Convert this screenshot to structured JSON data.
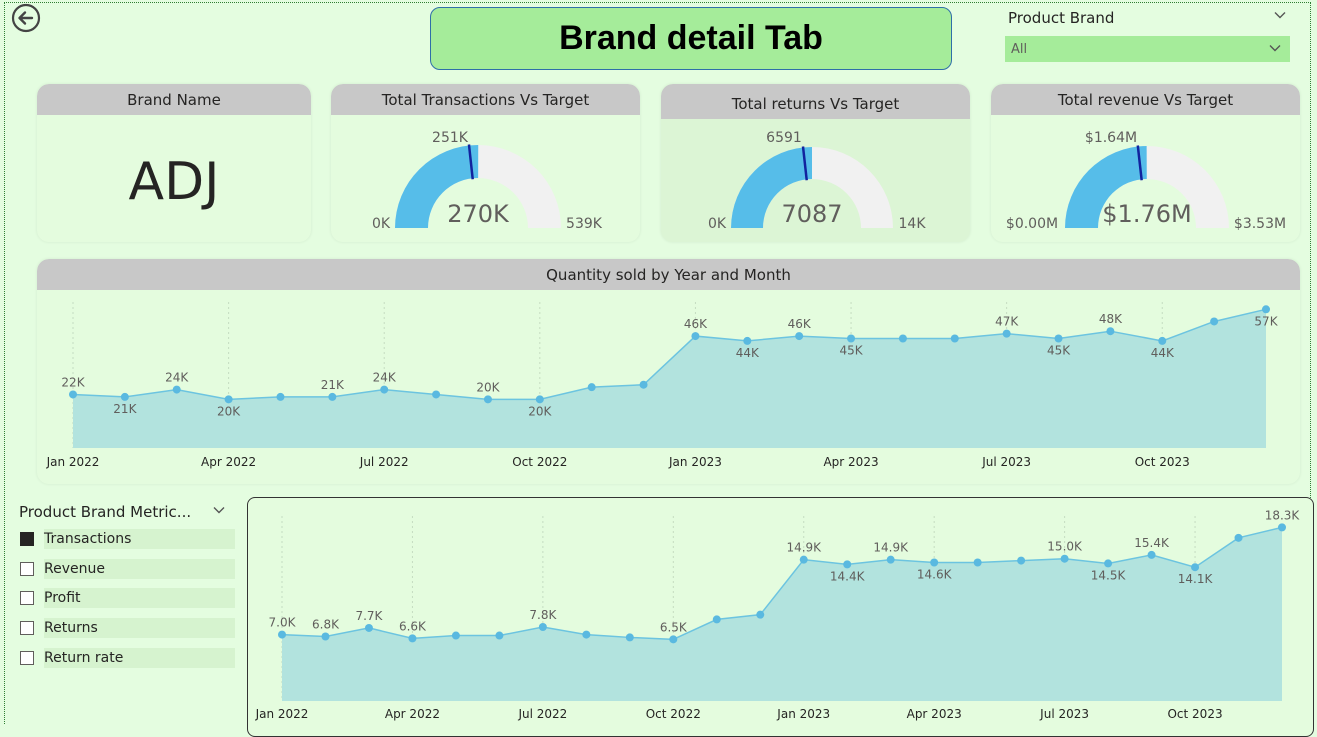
{
  "header": {
    "title": "Brand detail Tab"
  },
  "slicer": {
    "title": "Product Brand",
    "selected": "All"
  },
  "kpi": {
    "brand": {
      "title": "Brand Name",
      "value": "ADJ"
    },
    "transactions": {
      "title": "Total Transactions Vs Target",
      "value": "270K",
      "target": "251K",
      "min": "0K",
      "max": "539K",
      "value_num": 270,
      "target_num": 251,
      "max_num": 539
    },
    "returns": {
      "title": "Total returns Vs Target",
      "value": "7087",
      "target": "6591",
      "min": "0K",
      "max": "14K",
      "value_num": 7087,
      "target_num": 6591,
      "max_num": 14174
    },
    "revenue": {
      "title": "Total revenue Vs Target",
      "value": "$1.76M",
      "target": "$1.64M",
      "min": "$0.00M",
      "max": "$3.53M",
      "value_num": 1.76,
      "target_num": 1.64,
      "max_num": 3.53
    }
  },
  "colors": {
    "fill": "#56bde9",
    "track": "#f1f1f1",
    "target": "#12239e",
    "area": "#b2e3de",
    "line": "#6cc4e0",
    "point": "#5ab9e0"
  },
  "metric_slicer": {
    "title": "Product Brand Metric...",
    "items": [
      {
        "label": "Transactions",
        "checked": true
      },
      {
        "label": "Revenue",
        "checked": false
      },
      {
        "label": "Profit",
        "checked": false
      },
      {
        "label": "Returns",
        "checked": false
      },
      {
        "label": "Return rate",
        "checked": false
      }
    ]
  },
  "chart_data": [
    {
      "type": "area",
      "title": "Quantity sold by Year and Month",
      "x_ticks": [
        "Jan 2022",
        "Apr 2022",
        "Jul 2022",
        "Oct 2022",
        "Jan 2023",
        "Apr 2023",
        "Jul 2023",
        "Oct 2023"
      ],
      "values": [
        22,
        21,
        24,
        20,
        21,
        21,
        24,
        22,
        20,
        20,
        25,
        26,
        46,
        44,
        46,
        45,
        45,
        45,
        47,
        45,
        48,
        44,
        52,
        57
      ],
      "labels": [
        "22K",
        "21K",
        "24K",
        "20K",
        "",
        "21K",
        "24K",
        "",
        "20K",
        "20K",
        "",
        "",
        "46K",
        "44K",
        "46K",
        "45K",
        "",
        "",
        "47K",
        "45K",
        "48K",
        "44K",
        "",
        "57K"
      ],
      "label_pos": [
        "a",
        "b",
        "a",
        "b",
        "",
        "a",
        "a",
        "",
        "a",
        "b",
        "",
        "",
        "a",
        "b",
        "a",
        "b",
        "",
        "",
        "a",
        "b",
        "a",
        "b",
        "",
        "b"
      ],
      "ylim": [
        0,
        60
      ]
    },
    {
      "type": "area",
      "title": "",
      "x_ticks": [
        "Jan 2022",
        "Apr 2022",
        "Jul 2022",
        "Oct 2022",
        "Jan 2023",
        "Apr 2023",
        "Jul 2023",
        "Oct 2023"
      ],
      "values": [
        7.0,
        6.8,
        7.7,
        6.6,
        6.9,
        6.9,
        7.8,
        7.0,
        6.7,
        6.5,
        8.6,
        9.1,
        14.9,
        14.4,
        14.9,
        14.6,
        14.6,
        14.8,
        15.0,
        14.5,
        15.4,
        14.1,
        17.2,
        18.3
      ],
      "labels": [
        "7.0K",
        "6.8K",
        "7.7K",
        "6.6K",
        "",
        "",
        "7.8K",
        "",
        "",
        "6.5K",
        "",
        "",
        "14.9K",
        "14.4K",
        "14.9K",
        "14.6K",
        "",
        "",
        "15.0K",
        "14.5K",
        "15.4K",
        "14.1K",
        "",
        "18.3K"
      ],
      "label_pos": [
        "a",
        "a",
        "a",
        "a",
        "",
        "",
        "a",
        "",
        "",
        "a",
        "",
        "",
        "a",
        "b",
        "a",
        "b",
        "",
        "",
        "a",
        "b",
        "a",
        "b",
        "",
        "a"
      ],
      "ylim": [
        0,
        19.5
      ]
    }
  ]
}
